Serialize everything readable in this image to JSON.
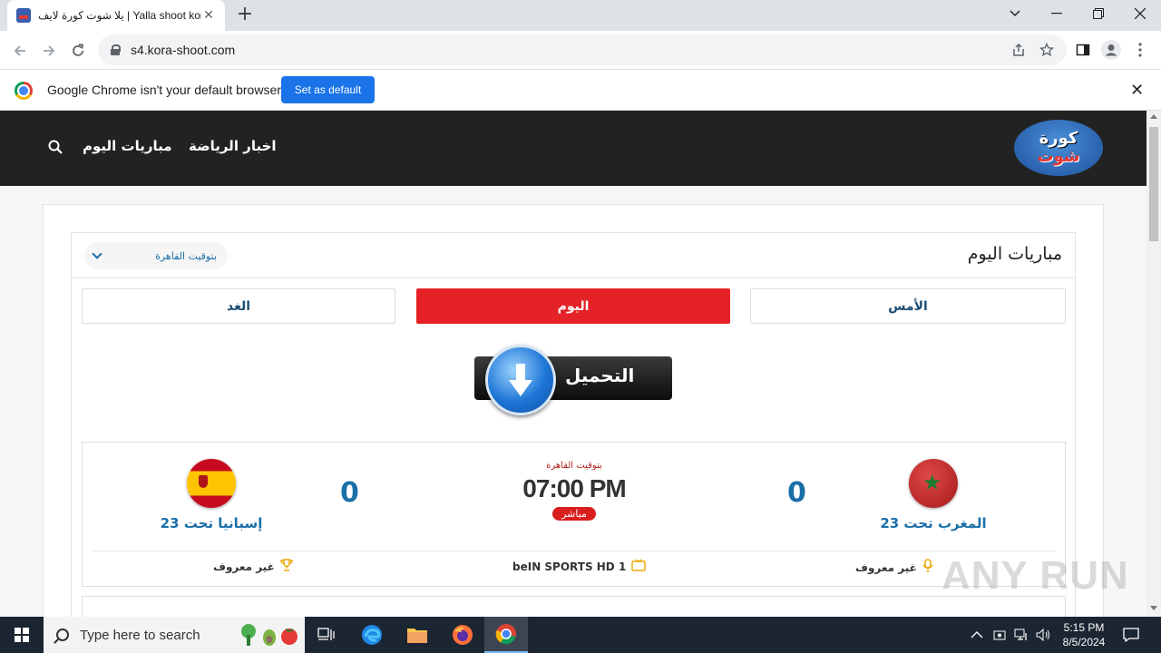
{
  "browser": {
    "tab_title": "يلا شوت كورة لايف | Yalla shoot kora live",
    "tab_close": "✕",
    "new_tab": "+",
    "url": "s4.kora-shoot.com",
    "infobar_message": "Google Chrome isn't your default browser",
    "infobar_button": "Set as default",
    "infobar_close": "✕"
  },
  "site": {
    "logo_line1": "كورة",
    "logo_line2": "شوت",
    "nav": {
      "news": "اخبار الرياضة",
      "matches_today": "مباريات اليوم"
    }
  },
  "matches": {
    "title": "مباريات اليوم",
    "timezone_label": "بتوقيت القاهرة",
    "tabs": {
      "yesterday": "الأمس",
      "today": "اليوم",
      "tomorrow": "الغد"
    },
    "ad_text": "التحميل",
    "match1": {
      "home_team": "المغرب تحت 23",
      "home_score": "0",
      "away_team": "إسبانيا تحت 23",
      "away_score": "0",
      "tz": "بتوقيت القاهرة",
      "time": "07:00 PM",
      "status": "مباشر",
      "commentator": "غير معروف",
      "channel": "beIN SPORTS HD 1",
      "tournament": "غير معروف"
    }
  },
  "watermark": "ANY RUN",
  "taskbar": {
    "search_placeholder": "Type here to search",
    "time": "5:15 PM",
    "date": "8/5/2024"
  },
  "colors": {
    "header_bg": "#222222",
    "active_tab": "#e52227",
    "team_name": "#1a6fa8",
    "chrome_blue": "#1a73e8"
  }
}
